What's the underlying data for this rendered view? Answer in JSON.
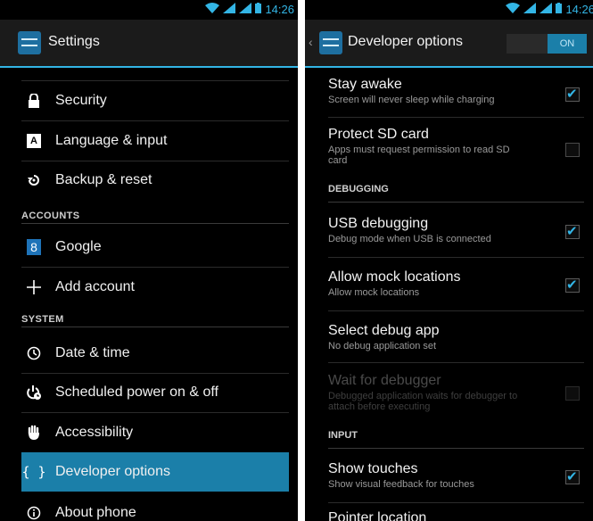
{
  "status": {
    "time": "14:26"
  },
  "left": {
    "title": "Settings",
    "items": [
      {
        "label": "Security",
        "icon": "lock-icon"
      },
      {
        "label": "Language & input",
        "icon": "keyboard-icon"
      },
      {
        "label": "Backup & reset",
        "icon": "backup-icon"
      },
      {
        "label": "Google",
        "icon": "google-icon"
      },
      {
        "label": "Add account",
        "icon": "plus-icon"
      },
      {
        "label": "Date & time",
        "icon": "clock-icon"
      },
      {
        "label": "Scheduled power on & off",
        "icon": "power-schedule-icon"
      },
      {
        "label": "Accessibility",
        "icon": "hand-icon"
      },
      {
        "label": "Developer options",
        "icon": "braces-icon"
      },
      {
        "label": "About phone",
        "icon": "info-icon"
      }
    ],
    "sections": {
      "accounts": "ACCOUNTS",
      "system": "SYSTEM"
    }
  },
  "right": {
    "title": "Developer options",
    "toggle": "ON",
    "sections": {
      "debugging": "DEBUGGING",
      "input": "INPUT"
    },
    "items": [
      {
        "title": "Stay awake",
        "subtitle": "Screen will never sleep while charging",
        "checked": true
      },
      {
        "title": "Protect SD card",
        "subtitle": "Apps must request permission to read SD card",
        "checked": false
      },
      {
        "title": "USB debugging",
        "subtitle": "Debug mode when USB is connected",
        "checked": true
      },
      {
        "title": "Allow mock locations",
        "subtitle": "Allow mock locations",
        "checked": true
      },
      {
        "title": "Select debug app",
        "subtitle": "No debug application set"
      },
      {
        "title": "Wait for debugger",
        "subtitle": "Debugged application waits for debugger to attach before executing",
        "checked": false,
        "disabled": true
      },
      {
        "title": "Show touches",
        "subtitle": "Show visual feedback for touches",
        "checked": true
      },
      {
        "title": "Pointer location",
        "subtitle": ""
      }
    ]
  },
  "colors": {
    "accent": "#33b5e5",
    "selected": "#1b7fa9"
  }
}
